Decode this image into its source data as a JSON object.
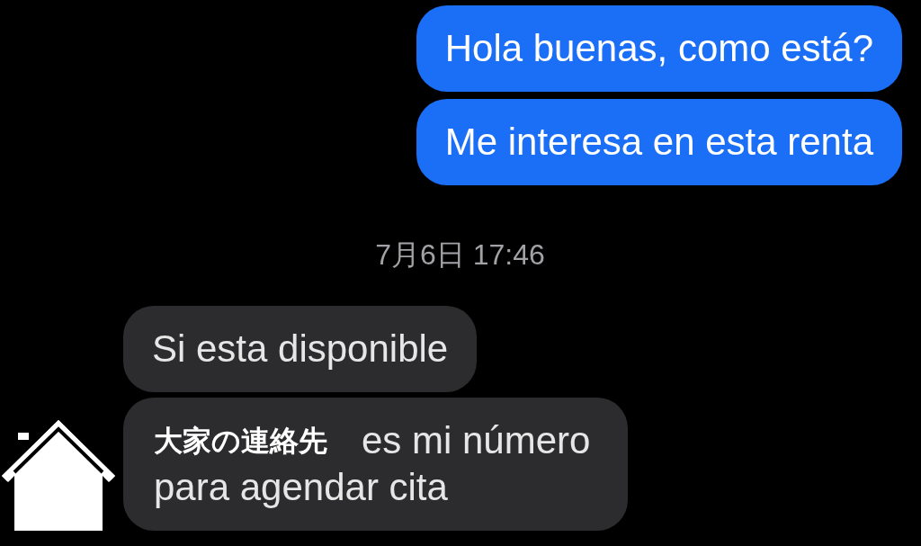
{
  "messages_before": [
    {
      "kind": "outgoing",
      "text": "Hola buenas, como está?"
    },
    {
      "kind": "outgoing",
      "text": "Me interesa en esta renta"
    }
  ],
  "timestamp": "7月6日 17:46",
  "messages_after": [
    {
      "kind": "incoming",
      "text": "Si esta disponible"
    },
    {
      "kind": "incoming",
      "label": "大家の連絡先",
      "lines": [
        "es mi número",
        "para agendar cita"
      ]
    }
  ]
}
